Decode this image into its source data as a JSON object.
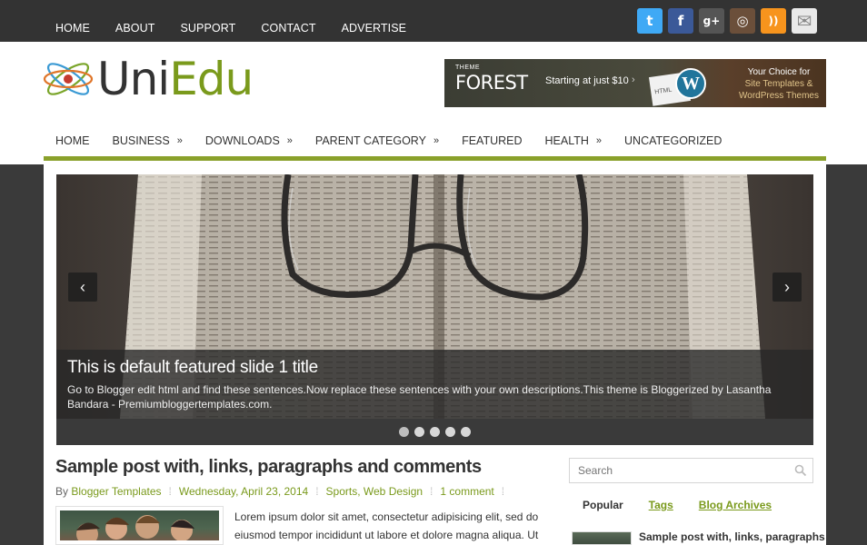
{
  "topnav": {
    "items": [
      "HOME",
      "ABOUT",
      "SUPPORT",
      "CONTACT",
      "ADVERTISE"
    ]
  },
  "social": {
    "twitter": {
      "glyph": "t",
      "color": "#3fa9f5"
    },
    "facebook": {
      "glyph": "f",
      "color": "#3b5998"
    },
    "googleplus": {
      "glyph": "g+",
      "color": "#555555"
    },
    "instagram": {
      "glyph": "◎",
      "color": "#6b4f3a"
    },
    "rss": {
      "glyph": "))",
      "color": "#f7941d"
    },
    "email": {
      "glyph": "✉",
      "color": "#e9e9e9"
    }
  },
  "logo": {
    "uni": "Uni",
    "edu": "Edu"
  },
  "banner": {
    "theme": "THEME",
    "forest": "FOREST",
    "starting": "Starting at just $10",
    "arrow": "›",
    "doc": "HTML",
    "wp": "W",
    "choice_1": "Your Choice for",
    "choice_2": "Site Templates &",
    "choice_3": "WordPress Themes"
  },
  "mainnav": {
    "items": [
      {
        "label": "HOME",
        "chevron": ""
      },
      {
        "label": "BUSINESS",
        "chevron": "»"
      },
      {
        "label": "DOWNLOADS",
        "chevron": "»"
      },
      {
        "label": "PARENT CATEGORY",
        "chevron": "»"
      },
      {
        "label": "FEATURED",
        "chevron": ""
      },
      {
        "label": "HEALTH",
        "chevron": "»"
      },
      {
        "label": "UNCATEGORIZED",
        "chevron": ""
      }
    ]
  },
  "slider": {
    "prev": "‹",
    "next": "›",
    "title": "This is default featured slide 1 title",
    "description": "Go to Blogger edit html and find these sentences.Now replace these sentences with your own descriptions.This theme is Bloggerized by Lasantha Bandara - Premiumbloggertemplates.com.",
    "dot_count": 5,
    "active_dot": 1
  },
  "post": {
    "title": "Sample post with, links, paragraphs and comments",
    "by": "By",
    "author": "Blogger Templates",
    "date": "Wednesday, April 23, 2014",
    "categories": "Sports, Web Design",
    "comments": "1 comment",
    "sep": "⁞",
    "excerpt": "Lorem ipsum dolor sit amet, consectetur adipisicing elit, sed do eiusmod tempor incididunt ut labore et dolore magna aliqua. Ut"
  },
  "sidebar": {
    "search_placeholder": "Search",
    "tabs": [
      {
        "label": "Popular",
        "state": "active"
      },
      {
        "label": "Tags",
        "state": "link"
      },
      {
        "label": "Blog Archives",
        "state": "link"
      }
    ],
    "popular_post_title": "Sample post with, links, paragraphs"
  },
  "colors": {
    "accent": "#8aa12b",
    "link": "#7a9a1c",
    "topbar": "#333333"
  }
}
